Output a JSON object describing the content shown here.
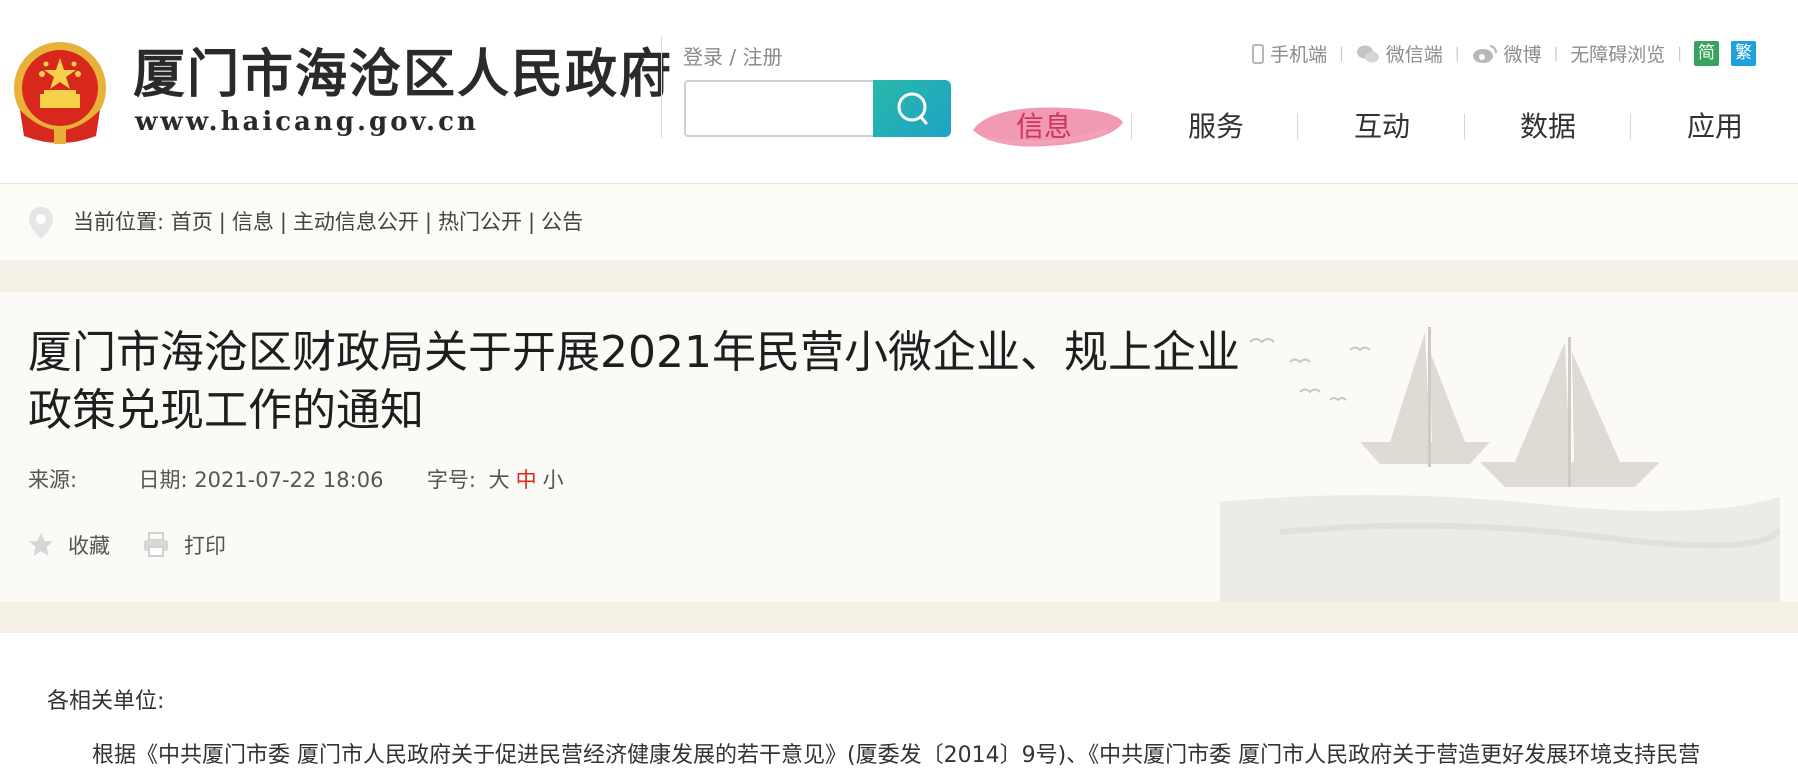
{
  "header": {
    "site_name": "厦门市海沧区人民政府",
    "site_url": "www.haicang.gov.cn",
    "login": "登录",
    "login_sep": " / ",
    "register": "注册",
    "search_placeholder": "",
    "top_links": {
      "mobile": "手机端",
      "wechat": "微信端",
      "weibo": "微博",
      "accessible": "无障碍浏览",
      "simplified": "简",
      "traditional": "繁"
    },
    "nav": [
      "信息",
      "服务",
      "互动",
      "数据",
      "应用"
    ],
    "active_nav": "信息"
  },
  "breadcrumb": {
    "label": "当前位置:",
    "items": [
      "首页",
      "信息",
      "主动信息公开",
      "热门公开",
      "公告"
    ],
    "sep": "|"
  },
  "article": {
    "title": "厦门市海沧区财政局关于开展2021年民营小微企业、规上企业政策兑现工作的通知",
    "source_label": "来源:",
    "source_value": "",
    "date_label": "日期:",
    "date_value": "2021-07-22 18:06",
    "fontsize_label": "字号:",
    "fontsize_large": "大",
    "fontsize_medium": "中",
    "fontsize_small": "小",
    "favorite": "收藏",
    "print": "打印",
    "salutation": "各相关单位:",
    "paragraph": "根据《中共厦门市委 厦门市人民政府关于促进民营经济健康发展的若干意见》(厦委发〔2014〕9号)、《中共厦门市委 厦门市人民政府关于营造更好发展环境支持民营"
  },
  "colors": {
    "accent_red": "#d1345b",
    "search_button": "#1fa3c6",
    "fontsize_active": "#e1261c",
    "badge_simplified": "#35a45a",
    "badge_traditional": "#1ea0dc",
    "band": "#f5f1e6"
  },
  "icons": {
    "emblem": "national-emblem-icon",
    "search": "search-icon",
    "mobile": "phone-icon",
    "wechat": "wechat-icon",
    "weibo": "weibo-icon",
    "location": "location-pin-icon",
    "favorite": "star-icon",
    "print": "printer-icon"
  }
}
